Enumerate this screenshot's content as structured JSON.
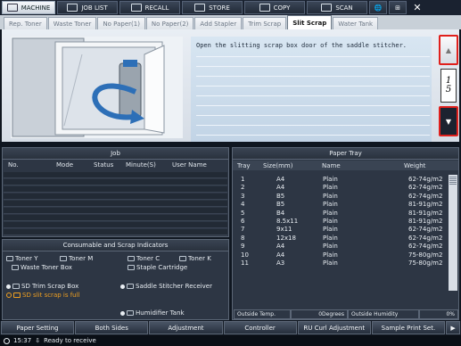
{
  "nav": [
    {
      "label": "MACHINE",
      "icon": "machine-icon",
      "active": true
    },
    {
      "label": "JOB LIST",
      "icon": "job-list-icon"
    },
    {
      "label": "RECALL",
      "icon": "recall-icon"
    },
    {
      "label": "STORE",
      "icon": "store-icon"
    },
    {
      "label": "COPY",
      "icon": "copy-icon"
    },
    {
      "label": "SCAN",
      "icon": "scan-icon"
    }
  ],
  "tabs": [
    "Rep. Toner",
    "Waste Toner",
    "No Paper(1)",
    "No Paper(2)",
    "Add Stapler",
    "Trim Scrap",
    "Slit Scrap",
    "Water Tank"
  ],
  "active_tab": "Slit Scrap",
  "guide": {
    "message": "Open the slitting scrap box door of the saddle stitcher.",
    "page_current": "1",
    "page_total": "5"
  },
  "job": {
    "title": "Job",
    "columns": [
      "No.",
      "Mode",
      "Status",
      "Minute(S)",
      "User Name"
    ]
  },
  "consumables": {
    "title": "Consumable and Scrap Indicators",
    "items": [
      {
        "label": "Toner Y",
        "icon": "toner-y-icon"
      },
      {
        "label": "Toner M",
        "icon": "toner-m-icon"
      },
      {
        "label": "Toner C",
        "icon": "toner-c-icon"
      },
      {
        "label": "Toner K",
        "icon": "toner-k-icon"
      },
      {
        "label": "Waste Toner Box",
        "icon": "waste-toner-icon"
      },
      {
        "label": "Staple Cartridge",
        "icon": "staple-icon"
      },
      {
        "label": "SD Trim Scrap Box",
        "icon": "trim-scrap-icon"
      },
      {
        "label": "Saddle Stitcher Receiver",
        "icon": "saddle-stitcher-icon"
      },
      {
        "label": "SD slit scrap is full",
        "icon": "slit-scrap-warning-icon",
        "warning": true
      },
      {
        "label": "Humidifier Tank",
        "icon": "humidifier-icon"
      }
    ]
  },
  "tray": {
    "title": "Paper Tray",
    "columns": [
      "Tray",
      "Size(mm)",
      "Name",
      "Weight"
    ],
    "rows": [
      {
        "tray": "1",
        "size": "A4",
        "name": "Plain",
        "weight": "62-74g/m2"
      },
      {
        "tray": "2",
        "size": "A4",
        "name": "Plain",
        "weight": "62-74g/m2"
      },
      {
        "tray": "3",
        "size": "B5",
        "name": "Plain",
        "weight": "62-74g/m2"
      },
      {
        "tray": "4",
        "size": "B5",
        "name": "Plain",
        "weight": "81-91g/m2"
      },
      {
        "tray": "5",
        "size": "B4",
        "name": "Plain",
        "weight": "81-91g/m2"
      },
      {
        "tray": "6",
        "size": "8.5x11",
        "name": "Plain",
        "weight": "81-91g/m2"
      },
      {
        "tray": "7",
        "size": "9x11",
        "name": "Plain",
        "weight": "62-74g/m2"
      },
      {
        "tray": "8",
        "size": "12x18",
        "name": "Plain",
        "weight": "62-74g/m2"
      },
      {
        "tray": "9",
        "size": "A4",
        "name": "Plain",
        "weight": "62-74g/m2"
      },
      {
        "tray": "10",
        "size": "A4",
        "name": "Plain",
        "weight": "75-80g/m2"
      },
      {
        "tray": "11",
        "size": "A3",
        "name": "Plain",
        "weight": "75-80g/m2"
      }
    ],
    "outside_temp_label": "Outside Temp.",
    "outside_temp_value": "0Degrees",
    "outside_humidity_label": "Outside Humidity",
    "outside_humidity_value": "0%"
  },
  "bottom": [
    "Paper Setting",
    "Both Sides",
    "Adjustment",
    "Controller",
    "RU Curl Adjustment",
    "Sample Print Set."
  ],
  "status": {
    "time": "15:37",
    "text": "Ready to receive"
  }
}
